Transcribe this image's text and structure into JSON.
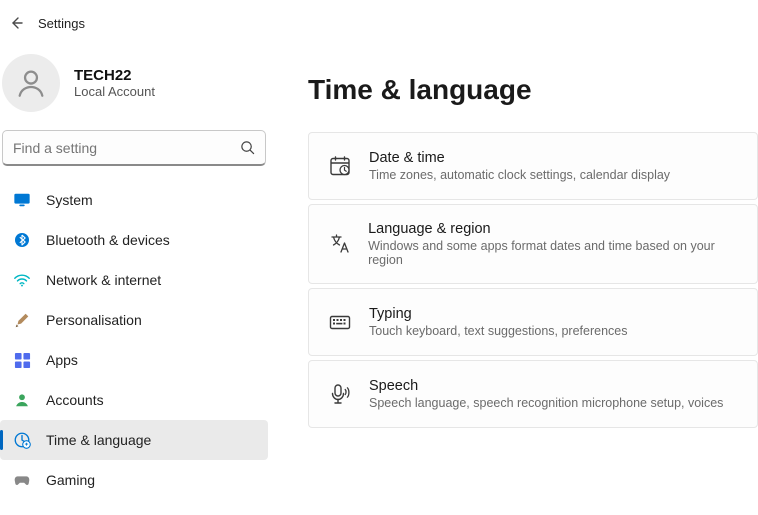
{
  "window": {
    "title": "Settings"
  },
  "user": {
    "name": "TECH22",
    "subtitle": "Local Account"
  },
  "search": {
    "placeholder": "Find a setting"
  },
  "sidebar": {
    "items": [
      {
        "label": "System",
        "icon": "system-icon"
      },
      {
        "label": "Bluetooth & devices",
        "icon": "bluetooth-icon"
      },
      {
        "label": "Network & internet",
        "icon": "wifi-icon"
      },
      {
        "label": "Personalisation",
        "icon": "brush-icon"
      },
      {
        "label": "Apps",
        "icon": "apps-icon"
      },
      {
        "label": "Accounts",
        "icon": "accounts-icon"
      },
      {
        "label": "Time & language",
        "icon": "time-language-icon"
      },
      {
        "label": "Gaming",
        "icon": "gaming-icon"
      }
    ],
    "selected_index": 6
  },
  "page": {
    "title": "Time & language",
    "cards": [
      {
        "title": "Date & time",
        "subtitle": "Time zones, automatic clock settings, calendar display",
        "icon": "date-time-icon"
      },
      {
        "title": "Language & region",
        "subtitle": "Windows and some apps format dates and time based on your region",
        "icon": "language-region-icon"
      },
      {
        "title": "Typing",
        "subtitle": "Touch keyboard, text suggestions, preferences",
        "icon": "typing-icon"
      },
      {
        "title": "Speech",
        "subtitle": "Speech language, speech recognition microphone setup, voices",
        "icon": "speech-icon"
      }
    ]
  }
}
